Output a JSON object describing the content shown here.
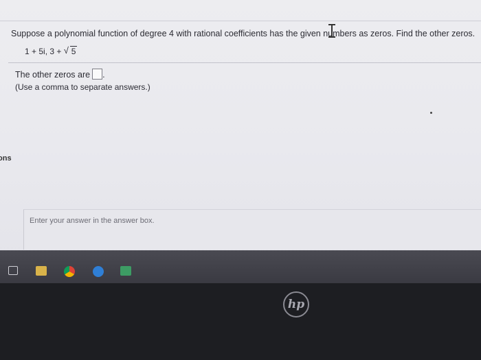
{
  "question": {
    "prompt_start": "Suppose a polynomial function of degree 4 with rational coefficients has the given numbers a",
    "prompt_end": "s zeros. Find the other zeros.",
    "given_zeros_prefix": "1 + 5i, 3 + ",
    "sqrt_symbol": "√",
    "radicand": "5"
  },
  "answer": {
    "label": "The other zeros are",
    "period": ".",
    "hint": "(Use a comma to separate answers.)"
  },
  "sidebar": {
    "partial_label": "ons"
  },
  "panel": {
    "enter_hint": "Enter your answer in the answer box."
  },
  "taskbar": {
    "icons": [
      "task-view-icon",
      "file-explorer-icon",
      "chrome-icon",
      "edge-icon",
      "store-icon"
    ]
  },
  "bezel": {
    "logo": "hp"
  },
  "colors": {
    "screen_bg": "#ececf0",
    "text": "#2b2b33",
    "taskbar": "#41414a",
    "bezel": "#1d1e22"
  }
}
